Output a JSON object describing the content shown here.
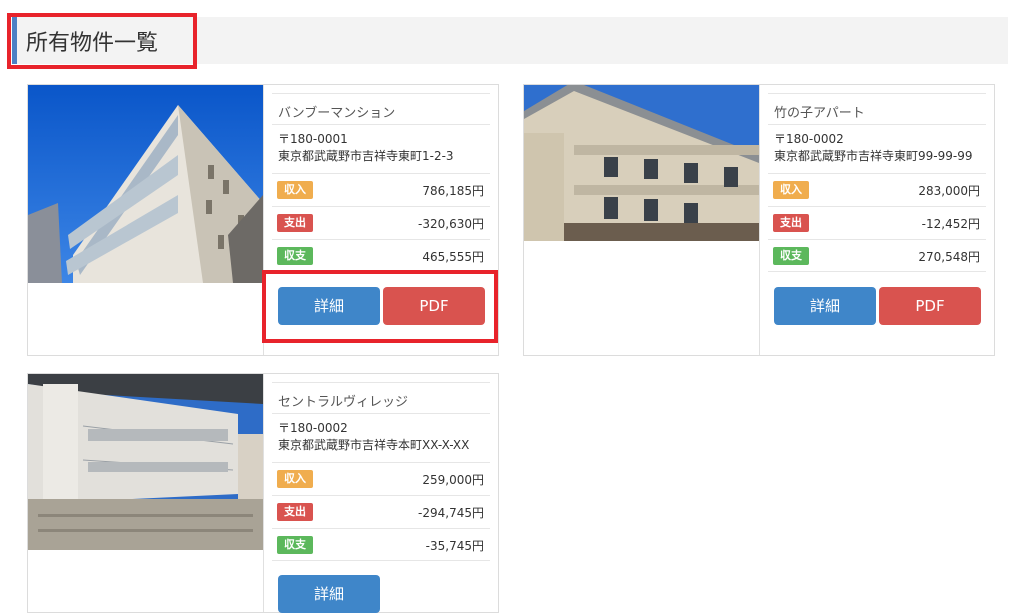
{
  "page": {
    "title": "所有物件一覧"
  },
  "colors": {
    "income": "#f0ad4e",
    "expense": "#d9534f",
    "balance": "#5cb85c",
    "detail_button": "#3f86c9",
    "pdf_button": "#d9534f",
    "highlight": "#e8232b"
  },
  "properties": [
    {
      "name": "バンブーマンション",
      "postal": "〒180-0001",
      "address": "東京都武蔵野市吉祥寺東町1-2-3",
      "income_label": "収入",
      "income": "786,185円",
      "expense_label": "支出",
      "expense": "-320,630円",
      "balance_label": "収支",
      "balance": "465,555円",
      "detail_label": "詳細",
      "pdf_label": "PDF"
    },
    {
      "name": "竹の子アパート",
      "postal": "〒180-0002",
      "address": "東京都武蔵野市吉祥寺東町99-99-99",
      "income_label": "収入",
      "income": "283,000円",
      "expense_label": "支出",
      "expense": "-12,452円",
      "balance_label": "収支",
      "balance": "270,548円",
      "detail_label": "詳細",
      "pdf_label": "PDF"
    },
    {
      "name": "セントラルヴィレッジ",
      "postal": "〒180-0002",
      "address": "東京都武蔵野市吉祥寺本町XX-X-XX",
      "income_label": "収入",
      "income": "259,000円",
      "expense_label": "支出",
      "expense": "-294,745円",
      "balance_label": "収支",
      "balance": "-35,745円",
      "detail_label": "詳細"
    }
  ]
}
